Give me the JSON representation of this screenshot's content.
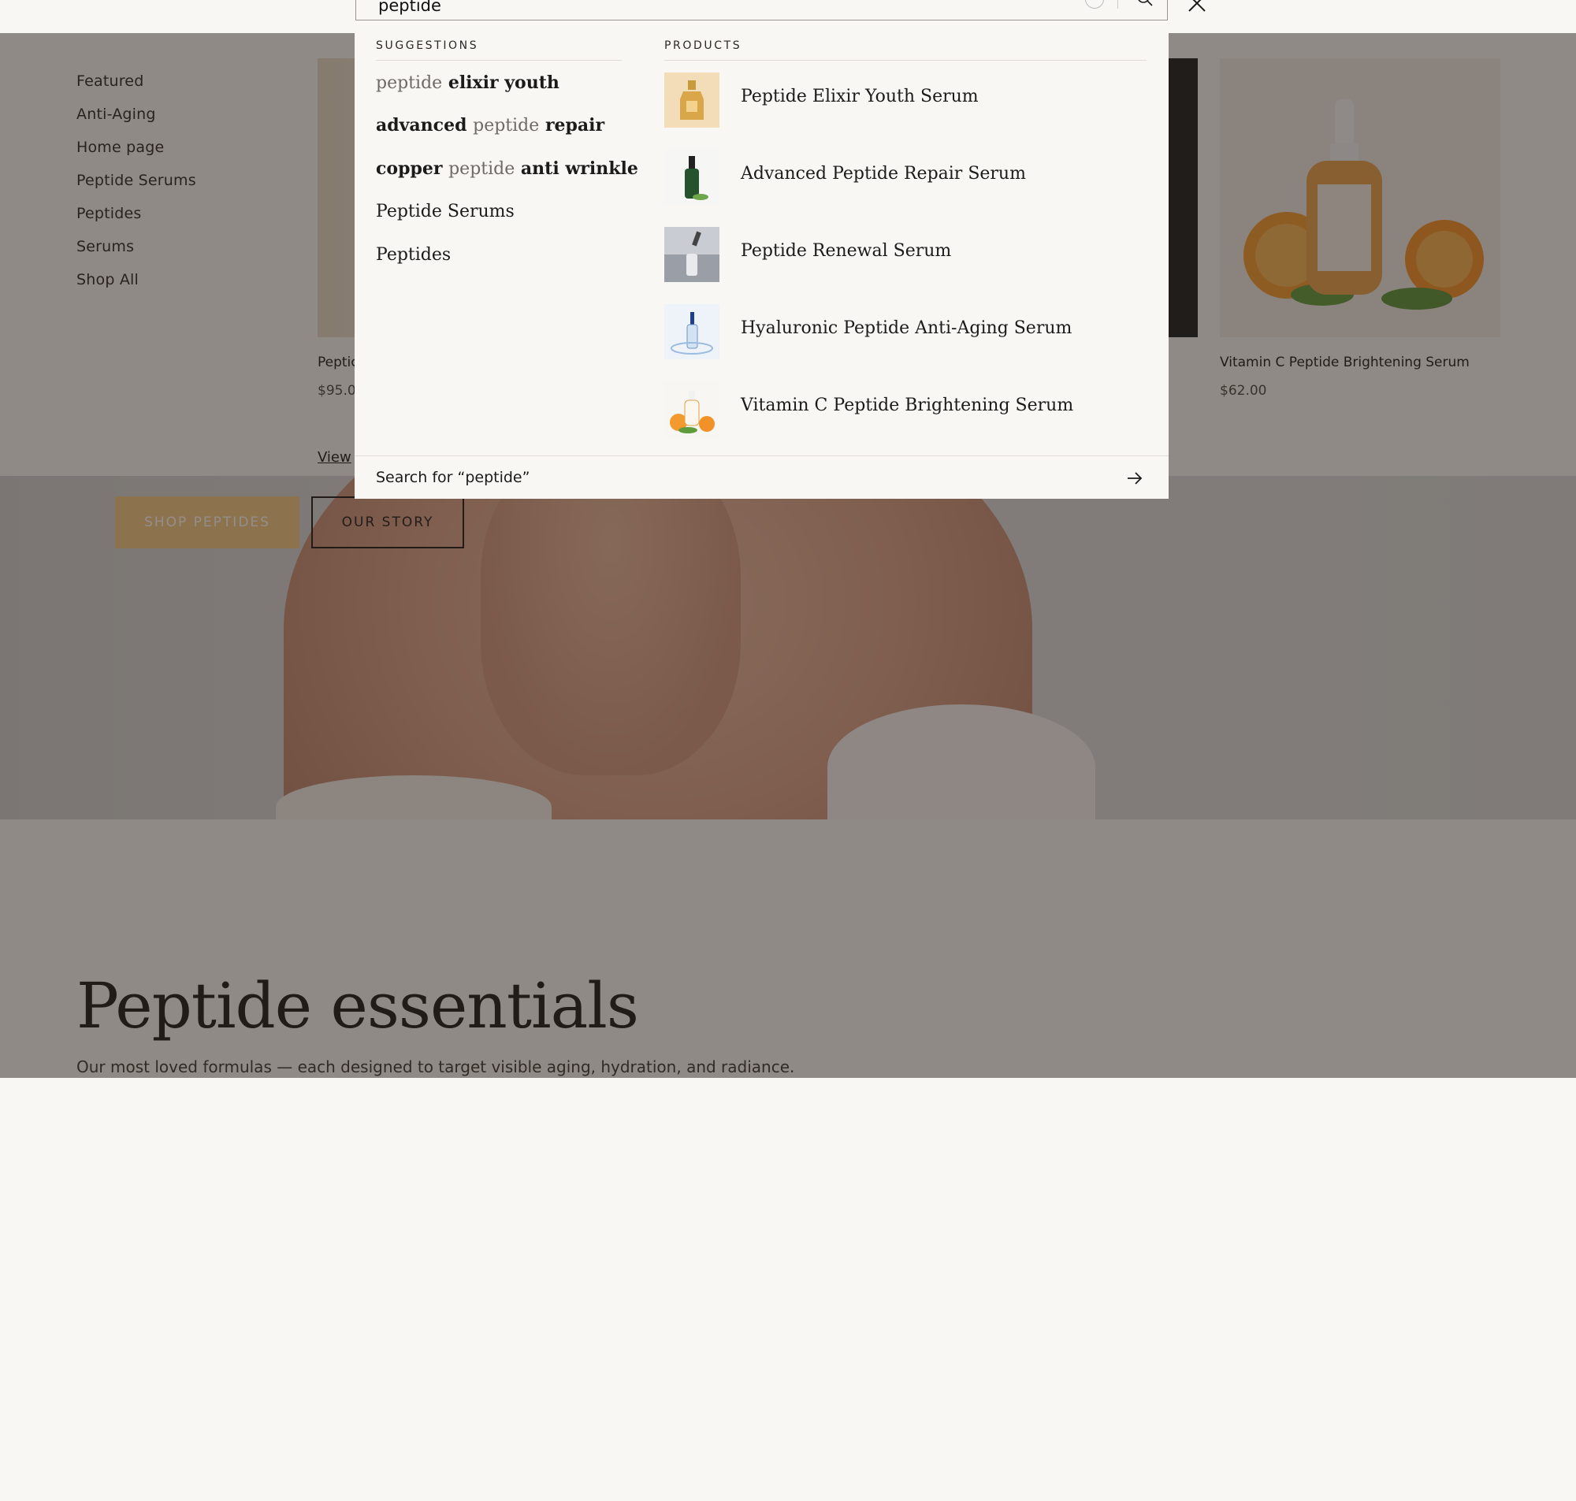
{
  "search": {
    "query": "peptide",
    "suggestions_label": "SUGGESTIONS",
    "products_label": "PRODUCTS",
    "suggestions": [
      {
        "parts": [
          {
            "text": "peptide",
            "style": "dim"
          },
          {
            "text": " elixir youth",
            "style": "bold"
          }
        ]
      },
      {
        "parts": [
          {
            "text": "advanced ",
            "style": "bold"
          },
          {
            "text": "peptide",
            "style": "dim"
          },
          {
            "text": " repair",
            "style": "bold"
          }
        ]
      },
      {
        "parts": [
          {
            "text": "copper ",
            "style": "bold"
          },
          {
            "text": "peptide",
            "style": "dim"
          },
          {
            "text": " anti wrinkle",
            "style": "bold"
          }
        ]
      },
      {
        "parts": [
          {
            "text": "Peptide Serums",
            "style": "plain"
          }
        ]
      },
      {
        "parts": [
          {
            "text": "Peptides",
            "style": "plain"
          }
        ]
      }
    ],
    "products": [
      {
        "name": "Peptide Elixir Youth Serum",
        "thumb": "gold-bottle-icon"
      },
      {
        "name": "Advanced Peptide Repair Serum",
        "thumb": "green-dropper-bottle-icon"
      },
      {
        "name": "Peptide Renewal Serum",
        "thumb": "glass-dropper-icon"
      },
      {
        "name": "Hyaluronic Peptide Anti-Aging Serum",
        "thumb": "blue-splash-bottle-icon"
      },
      {
        "name": "Vitamin C Peptide Brightening Serum",
        "thumb": "orange-serum-bottle-icon"
      }
    ],
    "search_for": "Search for “peptide”"
  },
  "menu": {
    "items": [
      "Featured",
      "Anti-Aging",
      "Home page",
      "Peptide Serums",
      "Peptides",
      "Serums",
      "Shop All"
    ]
  },
  "cards": [
    {
      "name": "Peptic",
      "price": "$95.0",
      "link": "View"
    },
    {
      "name": "Vitamin C Peptide Brightening Serum",
      "price": "$62.00"
    }
  ],
  "hero": {
    "shop_button": "SHOP PEPTIDES",
    "story_button": "OUR STORY"
  },
  "section": {
    "title": "Peptide essentials",
    "subtitle": "Our most loved formulas — each designed to target visible aging, hydration, and radiance."
  },
  "colors": {
    "accent": "#f3c785",
    "background": "#f8f7f4",
    "text": "#1d1b1a"
  }
}
